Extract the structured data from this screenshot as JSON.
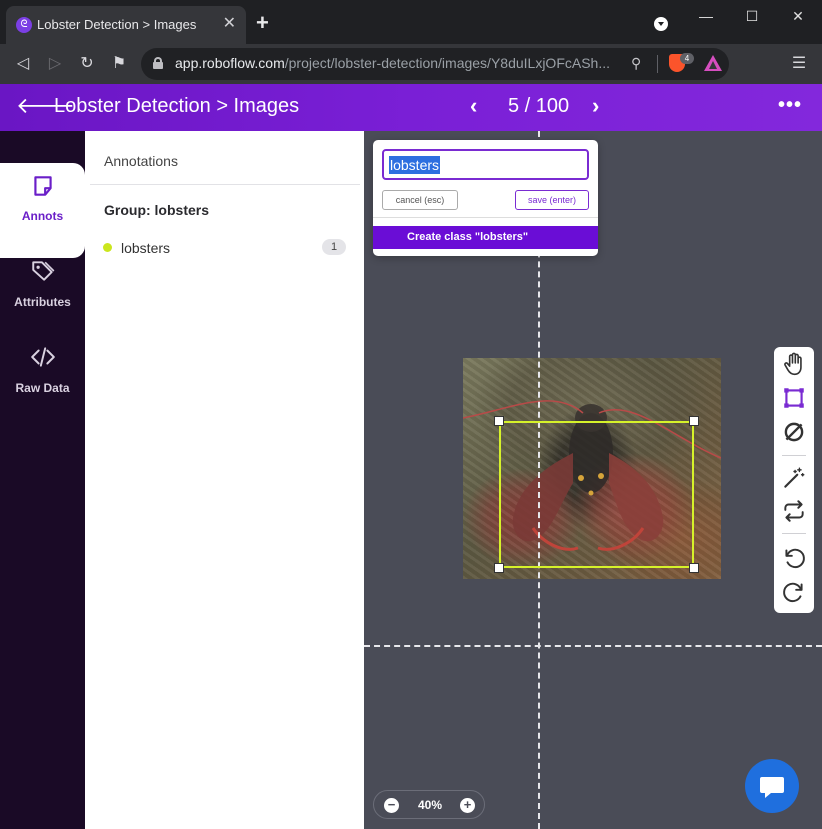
{
  "browser": {
    "tab_title": "Lobster Detection > Images",
    "url_host": "app.roboflow.com",
    "url_path": "/project/lobster-detection/images/Y8duILxjOFcASh...",
    "brave_badge": "4",
    "icons": [
      "roboflow-favicon",
      "close-icon",
      "plus-icon",
      "tab-search-icon",
      "minimize-icon",
      "maximize-icon",
      "window-close-icon",
      "back-icon",
      "forward-icon",
      "reload-icon",
      "bookmark-icon",
      "lock-icon",
      "zoom-icon",
      "brave-shields-icon",
      "brave-rewards-icon",
      "menu-icon"
    ]
  },
  "header": {
    "title": "Lobster Detection > Images",
    "pager": "5 / 100",
    "accent": "#6a16c4"
  },
  "rail": {
    "items": [
      {
        "label": "Annots",
        "icon": "note-icon",
        "active": true
      },
      {
        "label": "Attributes",
        "icon": "tag-icon",
        "active": false
      },
      {
        "label": "Raw Data",
        "icon": "code-icon",
        "active": false
      }
    ]
  },
  "panel": {
    "title": "Annotations",
    "group_title": "Group: lobsters",
    "classes": [
      {
        "name": "lobsters",
        "count": "1",
        "color": "#cbe61e"
      }
    ]
  },
  "popup": {
    "input_value": "lobsters",
    "cancel_label": "cancel (esc)",
    "save_label": "save (enter)",
    "create_label": "Create class \"lobsters\""
  },
  "tools": [
    "hand-icon",
    "bounding-box-icon",
    "polygon-null-icon",
    "magic-wand-icon",
    "repeat-icon",
    "undo-icon",
    "redo-icon"
  ],
  "zoom": {
    "level": "40%"
  },
  "chat": {
    "icon": "chat-icon"
  }
}
